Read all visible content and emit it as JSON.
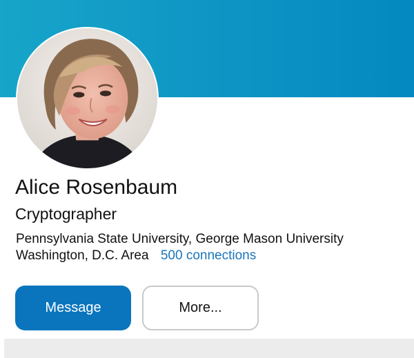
{
  "profile": {
    "name": "Alice Rosenbaum",
    "headline": "Cryptographer",
    "education": "Pennsylvania State University, George Mason University",
    "location": "Washington, D.C. Area",
    "connections": "500 connections",
    "avatar_icon": "profile-photo"
  },
  "actions": {
    "message_label": "Message",
    "more_label": "More..."
  },
  "colors": {
    "banner": "#0e94c4",
    "primary_button": "#0a75bd",
    "link": "#1a75bb"
  }
}
